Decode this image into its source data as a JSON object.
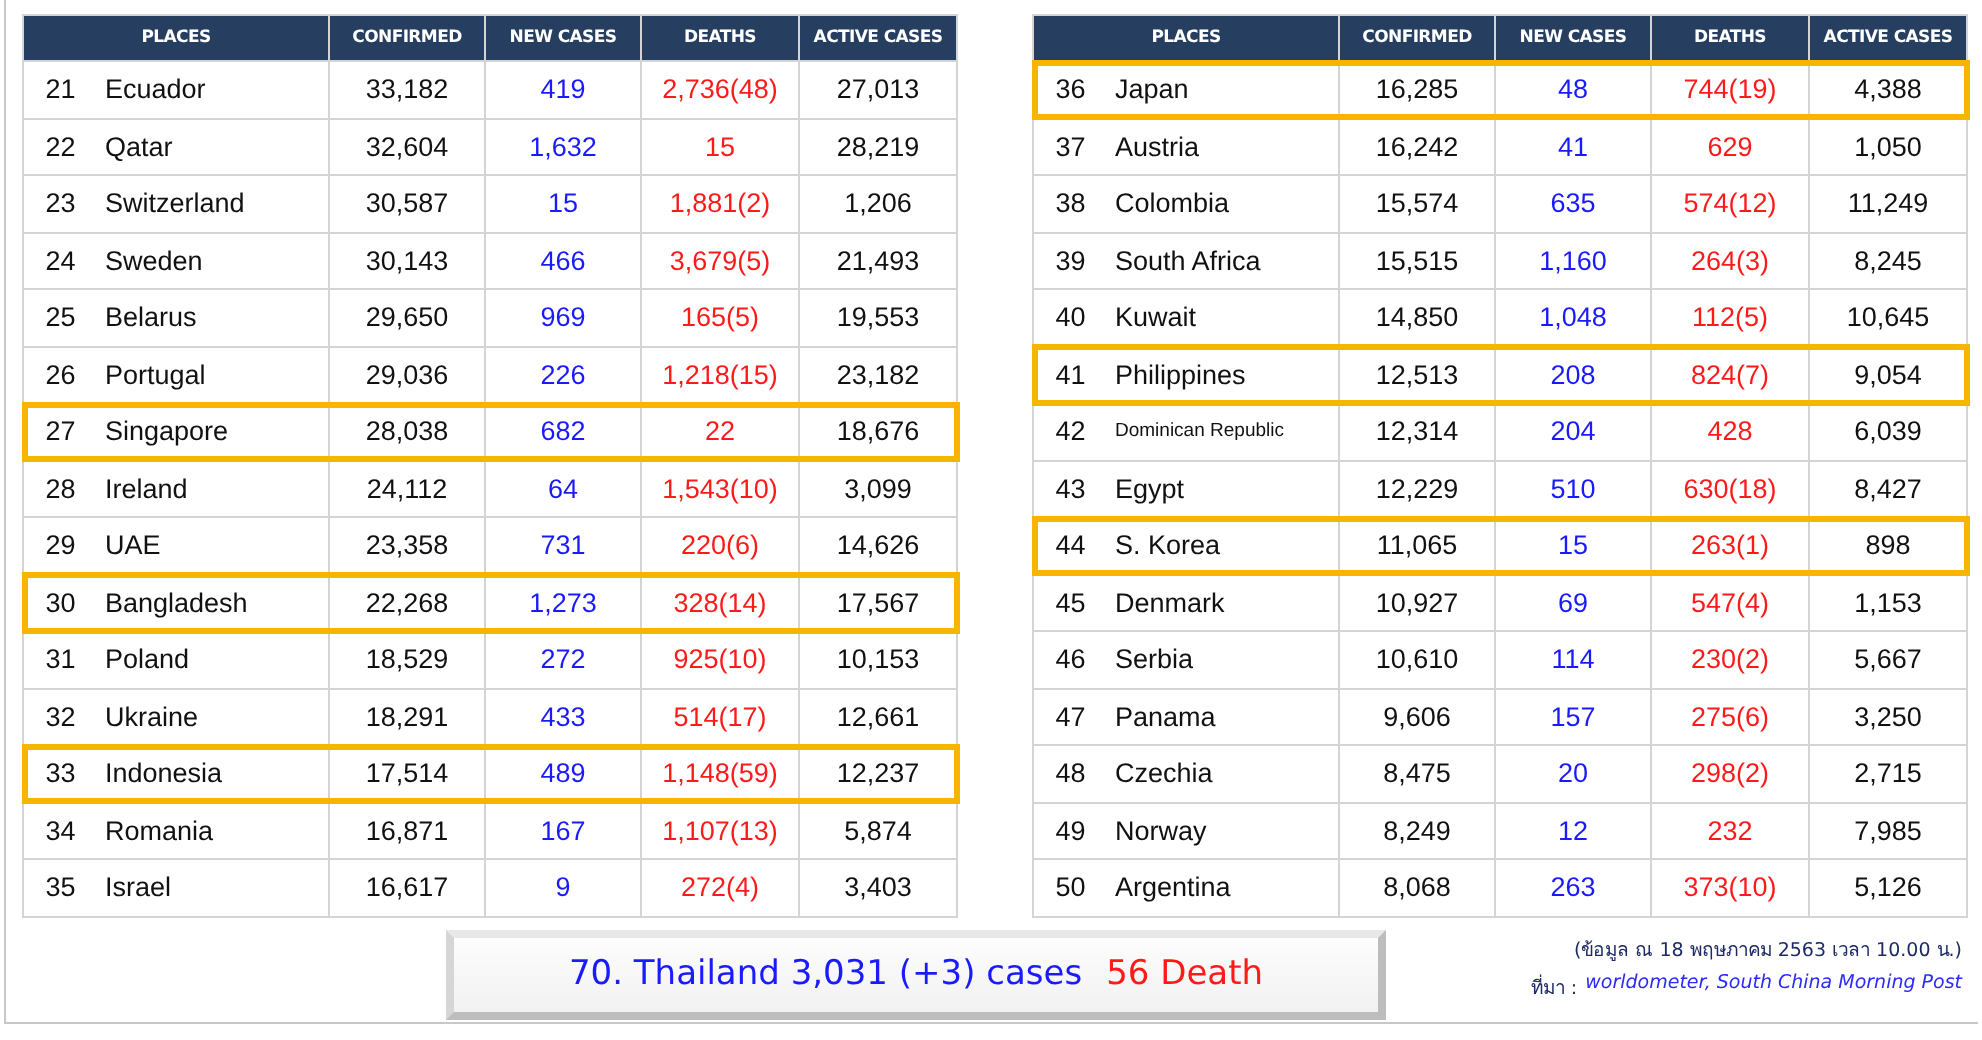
{
  "tables": [
    {
      "columns": [
        "PLACES",
        "CONFIRMED",
        "NEW  CASES",
        "DEATHS",
        "ACTIVE CASES"
      ],
      "rows": [
        {
          "rank": "21",
          "place": "Ecuador",
          "confirmed": "33,182",
          "new_cases": "419",
          "deaths": "2,736(48)",
          "active": "27,013",
          "highlighted": false
        },
        {
          "rank": "22",
          "place": "Qatar",
          "confirmed": "32,604",
          "new_cases": "1,632",
          "deaths": "15",
          "active": "28,219",
          "highlighted": false
        },
        {
          "rank": "23",
          "place": "Switzerland",
          "confirmed": "30,587",
          "new_cases": "15",
          "deaths": "1,881(2)",
          "active": "1,206",
          "highlighted": false
        },
        {
          "rank": "24",
          "place": "Sweden",
          "confirmed": "30,143",
          "new_cases": "466",
          "deaths": "3,679(5)",
          "active": "21,493",
          "highlighted": false
        },
        {
          "rank": "25",
          "place": "Belarus",
          "confirmed": "29,650",
          "new_cases": "969",
          "deaths": "165(5)",
          "active": "19,553",
          "highlighted": false
        },
        {
          "rank": "26",
          "place": "Portugal",
          "confirmed": "29,036",
          "new_cases": "226",
          "deaths": "1,218(15)",
          "active": "23,182",
          "highlighted": false
        },
        {
          "rank": "27",
          "place": "Singapore",
          "confirmed": "28,038",
          "new_cases": "682",
          "deaths": "22",
          "active": "18,676",
          "highlighted": true
        },
        {
          "rank": "28",
          "place": "Ireland",
          "confirmed": "24,112",
          "new_cases": "64",
          "deaths": "1,543(10)",
          "active": "3,099",
          "highlighted": false
        },
        {
          "rank": "29",
          "place": "UAE",
          "confirmed": "23,358",
          "new_cases": "731",
          "deaths": "220(6)",
          "active": "14,626",
          "highlighted": false
        },
        {
          "rank": "30",
          "place": "Bangladesh",
          "confirmed": "22,268",
          "new_cases": "1,273",
          "deaths": "328(14)",
          "active": "17,567",
          "highlighted": true
        },
        {
          "rank": "31",
          "place": "Poland",
          "confirmed": "18,529",
          "new_cases": "272",
          "deaths": "925(10)",
          "active": "10,153",
          "highlighted": false
        },
        {
          "rank": "32",
          "place": "Ukraine",
          "confirmed": "18,291",
          "new_cases": "433",
          "deaths": "514(17)",
          "active": "12,661",
          "highlighted": false
        },
        {
          "rank": "33",
          "place": "Indonesia",
          "confirmed": "17,514",
          "new_cases": "489",
          "deaths": "1,148(59)",
          "active": "12,237",
          "highlighted": true
        },
        {
          "rank": "34",
          "place": "Romania",
          "confirmed": "16,871",
          "new_cases": "167",
          "deaths": "1,107(13)",
          "active": "5,874",
          "highlighted": false
        },
        {
          "rank": "35",
          "place": "Israel",
          "confirmed": "16,617",
          "new_cases": "9",
          "deaths": "272(4)",
          "active": "3,403",
          "highlighted": false
        }
      ]
    },
    {
      "columns": [
        "PLACES",
        "CONFIRMED",
        "NEW  CASES",
        "DEATHS",
        "ACTIVE CASES"
      ],
      "rows": [
        {
          "rank": "36",
          "place": "Japan",
          "confirmed": "16,285",
          "new_cases": "48",
          "deaths": "744(19)",
          "active": "4,388",
          "highlighted": true
        },
        {
          "rank": "37",
          "place": "Austria",
          "confirmed": "16,242",
          "new_cases": "41",
          "deaths": "629",
          "active": "1,050",
          "highlighted": false
        },
        {
          "rank": "38",
          "place": "Colombia",
          "confirmed": "15,574",
          "new_cases": "635",
          "deaths": "574(12)",
          "active": "11,249",
          "highlighted": false
        },
        {
          "rank": "39",
          "place": "South Africa",
          "confirmed": "15,515",
          "new_cases": "1,160",
          "deaths": "264(3)",
          "active": "8,245",
          "highlighted": false
        },
        {
          "rank": "40",
          "place": "Kuwait",
          "confirmed": "14,850",
          "new_cases": "1,048",
          "deaths": "112(5)",
          "active": "10,645",
          "highlighted": false
        },
        {
          "rank": "41",
          "place": "Philippines",
          "confirmed": "12,513",
          "new_cases": "208",
          "deaths": "824(7)",
          "active": "9,054",
          "highlighted": true
        },
        {
          "rank": "42",
          "place": "Dominican Republic",
          "confirmed": "12,314",
          "new_cases": "204",
          "deaths": "428",
          "active": "6,039",
          "highlighted": false,
          "small": true
        },
        {
          "rank": "43",
          "place": "Egypt",
          "confirmed": "12,229",
          "new_cases": "510",
          "deaths": "630(18)",
          "active": "8,427",
          "highlighted": false
        },
        {
          "rank": "44",
          "place": "S. Korea",
          "confirmed": "11,065",
          "new_cases": "15",
          "deaths": "263(1)",
          "active": "898",
          "highlighted": true
        },
        {
          "rank": "45",
          "place": "Denmark",
          "confirmed": "10,927",
          "new_cases": "69",
          "deaths": "547(4)",
          "active": "1,153",
          "highlighted": false
        },
        {
          "rank": "46",
          "place": "Serbia",
          "confirmed": "10,610",
          "new_cases": "114",
          "deaths": "230(2)",
          "active": "5,667",
          "highlighted": false
        },
        {
          "rank": "47",
          "place": "Panama",
          "confirmed": "9,606",
          "new_cases": "157",
          "deaths": "275(6)",
          "active": "3,250",
          "highlighted": false
        },
        {
          "rank": "48",
          "place": "Czechia",
          "confirmed": "8,475",
          "new_cases": "20",
          "deaths": "298(2)",
          "active": "2,715",
          "highlighted": false
        },
        {
          "rank": "49",
          "place": "Norway",
          "confirmed": "8,249",
          "new_cases": "12",
          "deaths": "232",
          "active": "7,985",
          "highlighted": false
        },
        {
          "rank": "50",
          "place": "Argentina",
          "confirmed": "8,068",
          "new_cases": "263",
          "deaths": "373(10)",
          "active": "5,126",
          "highlighted": false
        }
      ]
    }
  ],
  "thailand": {
    "summary": "70. Thailand 3,031 (+3) cases",
    "deaths": "56  Death"
  },
  "note": "(ข้อมูล ณ 18 พฤษภาคม 2563 เวลา 10.00 น.)",
  "source": {
    "label": "ที่มา :",
    "text": "worldometer, South China Morning Post"
  }
}
